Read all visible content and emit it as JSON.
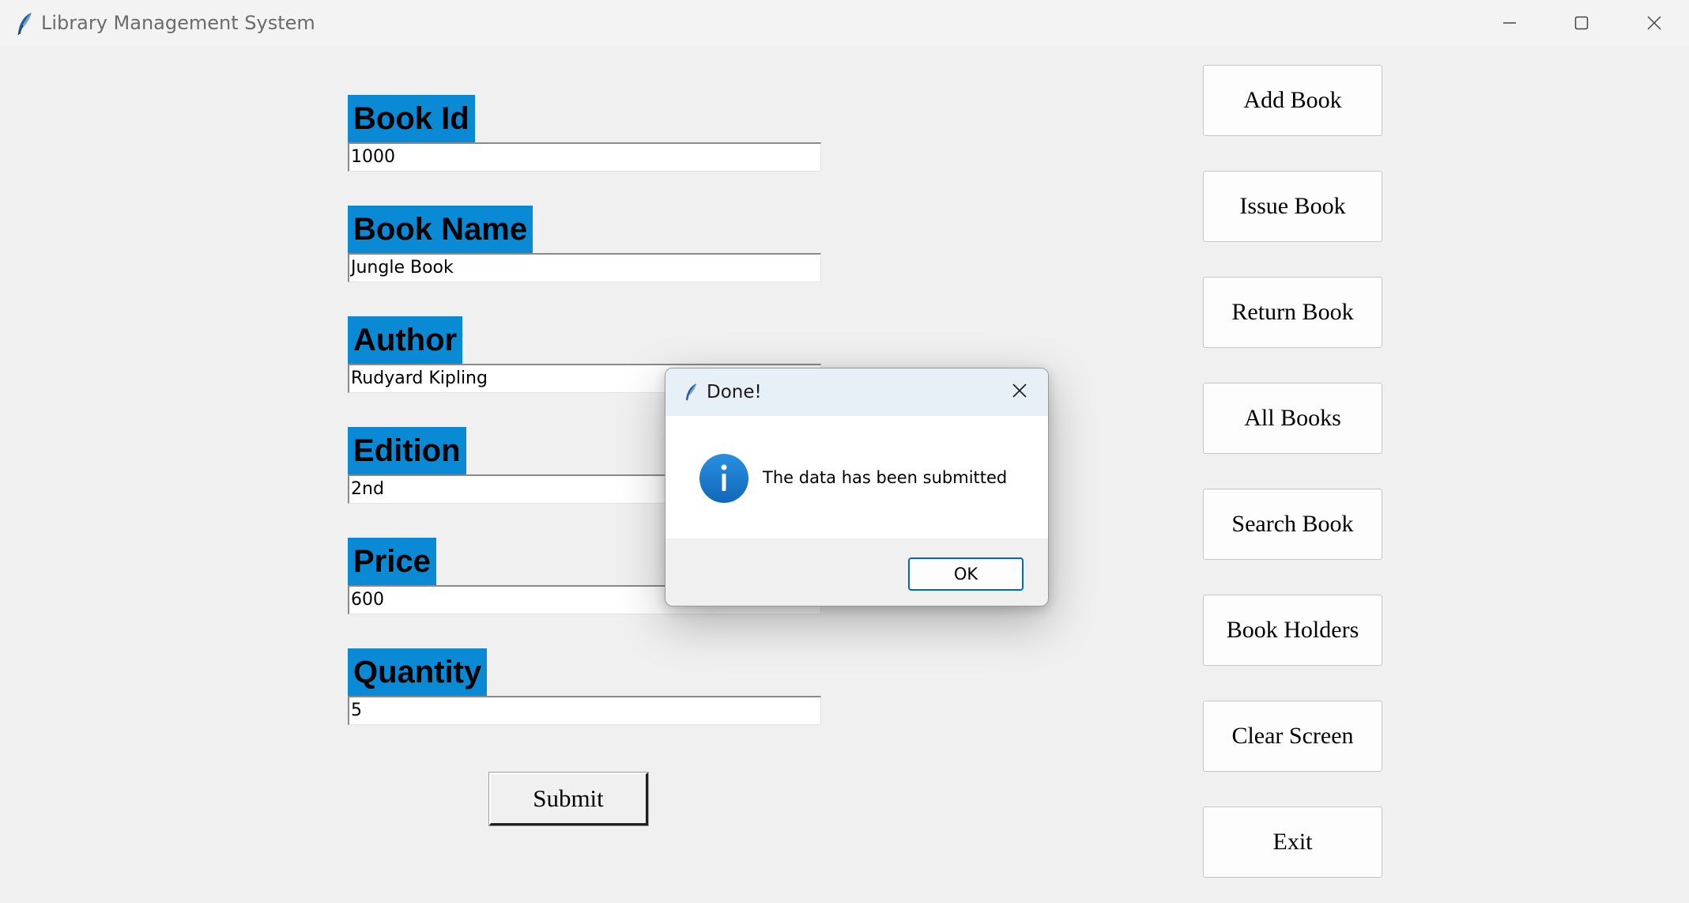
{
  "window": {
    "title": "Library Management System",
    "icon": "feather-icon",
    "controls": [
      "minimize-icon",
      "maximize-icon",
      "close-icon"
    ]
  },
  "form": {
    "fields": [
      {
        "label": "Book Id",
        "value": "1000"
      },
      {
        "label": "Book Name",
        "value": "Jungle Book"
      },
      {
        "label": "Author",
        "value": "Rudyard Kipling"
      },
      {
        "label": "Edition",
        "value": "2nd"
      },
      {
        "label": "Price",
        "value": "600"
      },
      {
        "label": "Quantity",
        "value": "5"
      }
    ],
    "submit_label": "Submit"
  },
  "menu": {
    "buttons": [
      "Add Book",
      "Issue Book",
      "Return Book",
      "All Books",
      "Search Book",
      "Book Holders",
      "Clear Screen",
      "Exit"
    ]
  },
  "dialog": {
    "title": "Done!",
    "message": "The data has been submitted",
    "ok_label": "OK",
    "icon": "info-icon"
  },
  "colors": {
    "label_bg": "#0a8ad4",
    "window_bg": "#f0f0f0",
    "accent": "#0067c0"
  }
}
